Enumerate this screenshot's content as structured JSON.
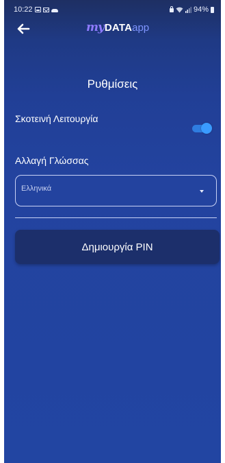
{
  "status_bar": {
    "time": "10:22",
    "battery": "94%",
    "left_icons": [
      "photo-icon",
      "mail-icon",
      "cloud-icon"
    ],
    "right_icons": [
      "lock-icon",
      "wifi-icon",
      "signal-icon",
      "battery-icon"
    ]
  },
  "app_bar": {
    "back_icon": "arrow-left-icon",
    "logo": {
      "my": "my",
      "data": "DATA",
      "app": "app"
    }
  },
  "settings": {
    "title": "Ρυθμίσεις",
    "dark_mode": {
      "label": "Σκοτεινή Λειτουργία",
      "enabled": true
    },
    "language": {
      "label": "Αλλαγή Γλώσσας",
      "selected": "Ελληνικά"
    },
    "create_pin_label": "Δημιουργία PIN"
  },
  "colors": {
    "background": "#2245a2",
    "toggle_on": "#3a9bff",
    "button": "#1c2f6b",
    "logo_accent": "#8f7bff"
  }
}
